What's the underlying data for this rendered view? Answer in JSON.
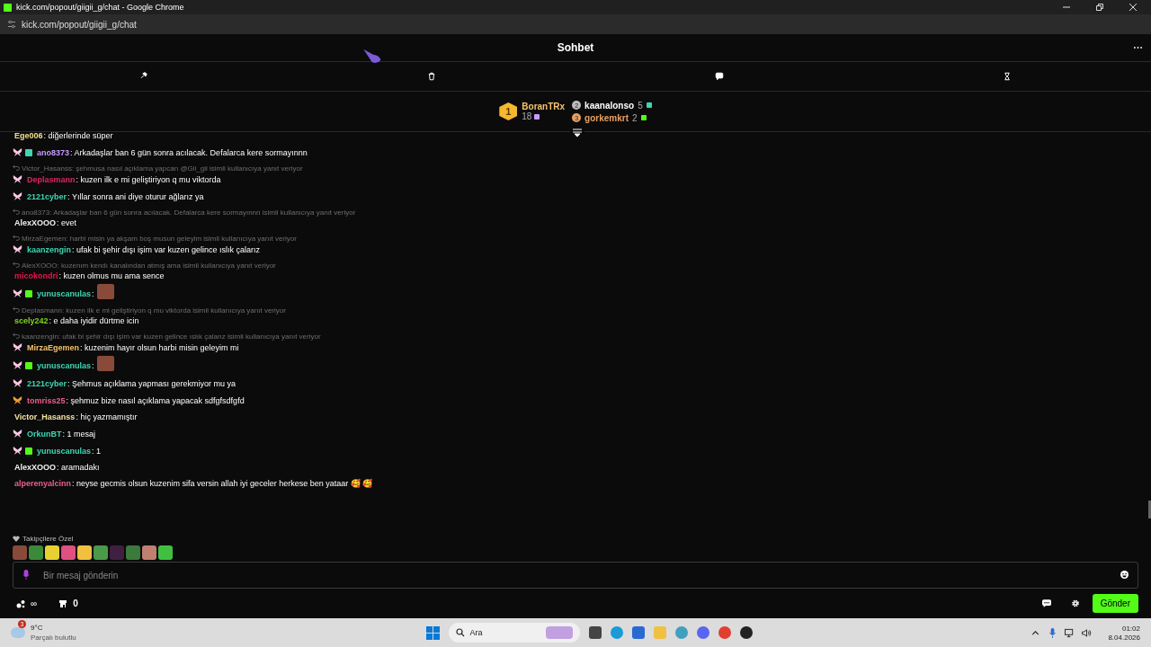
{
  "window": {
    "title": "kick.com/popout/giigii_g/chat - Google Chrome",
    "address": "kick.com/popout/giigii_g/chat"
  },
  "chat": {
    "title": "Sohbet"
  },
  "mod_tools": [
    {
      "kind": "hammer"
    },
    {
      "kind": "trash"
    },
    {
      "kind": "chat"
    },
    {
      "kind": "hourglass"
    }
  ],
  "leaderboard": {
    "top": {
      "rank": "1",
      "name": "BoranTRx",
      "count": "18"
    },
    "others": [
      {
        "rank": "2",
        "name": "kaanalonso",
        "count": "5",
        "color": "#ffffff",
        "gift": {
          "color": "#3ed6b2"
        }
      },
      {
        "rank": "3",
        "name": "gorkemkrt",
        "count": "2",
        "color": "#e8a060",
        "gift": {
          "color": "#53fc18"
        }
      }
    ]
  },
  "messages": [
    {
      "user": "Ege006",
      "color": "#f0e08a",
      "text": ": diğerlerinde süper"
    },
    {
      "user": "ano8373",
      "color": "#c79bff",
      "text": ": Arkadaşlar ban 6 gün sonra acılacak. Defalarca kere sormayınnn",
      "badges": [
        {
          "kind": "butterfly",
          "color": "#ffc8e6"
        },
        {
          "kind": "gift",
          "color": "#3ed6b2"
        }
      ]
    },
    {
      "reply": "Victor_Hasanss: şehmusa nasıl açıklama yapcan @Gii_gii isimli kullanıcıya yanıt veriyor",
      "user": "Deplasmann",
      "color": "#e0245e",
      "text": ": kuzen ilk e mi geliştiriyon q mu viktorda",
      "badges": [
        {
          "kind": "butterfly",
          "color": "#ffc8e6"
        }
      ]
    },
    {
      "user": "2121cyber",
      "color": "#3ed6b2",
      "text": ": Yıllar sonra ani diye oturur ağlarız ya",
      "badges": [
        {
          "kind": "butterfly",
          "color": "#ffc8e6"
        }
      ]
    },
    {
      "reply": "ano8373: Arkadaşlar ban 6 gün sonra acılacak. Defalarca kere sormayınnn isimli kullanıcıya yanıt veriyor",
      "user": "AlexXOOO",
      "color": "#f2f2f2",
      "text": ": evet"
    },
    {
      "reply": "MirzaEgemen: harbi misin ya akşam boş musun geleyim isimli kullanıcıya yanıt veriyor",
      "user": "kaanzengin",
      "color": "#3ed6b2",
      "text": ": ufak bi şehir dışı işim var kuzen gelince ıslık çalarız",
      "badges": [
        {
          "kind": "butterfly",
          "color": "#ffc8e6"
        }
      ]
    },
    {
      "reply": "AlexXOOO: kuzenım kendı kanalından atmış ama isimli kullanıcıya yanıt veriyor",
      "user": "micokondri",
      "color": "#e8174a",
      "text": ": kuzen olmus mu ama sence"
    },
    {
      "user": "yunuscanulas",
      "color": "#3ed6b2",
      "text": ":",
      "emote": true,
      "badges": [
        {
          "kind": "butterfly",
          "color": "#ffc8e6"
        },
        {
          "kind": "gift",
          "color": "#53fc18"
        }
      ]
    },
    {
      "reply": "Deplasmann: kuzen ilk e mi geliştiriyon q mu viktorda isimli kullanıcıya yanıt veriyor",
      "user": "scely242",
      "color": "#7ed321",
      "text": ": e daha iyidir dürtme icin"
    },
    {
      "reply": "kaanzengin: ufak bi şehir dışı işim var kuzen gelince ıslık çalarız isimli kullanıcıya yanıt veriyor",
      "user": "MirzaEgemen",
      "color": "#f5c26b",
      "text": ": kuzenim hayır olsun harbi misin geleyim mi",
      "badges": [
        {
          "kind": "butterfly",
          "color": "#ffc8e6"
        }
      ]
    },
    {
      "user": "yunuscanulas",
      "color": "#3ed6b2",
      "text": ":",
      "emote": true,
      "badges": [
        {
          "kind": "butterfly",
          "color": "#ffc8e6"
        },
        {
          "kind": "gift",
          "color": "#53fc18"
        }
      ]
    },
    {
      "user": "2121cyber",
      "color": "#3ed6b2",
      "text": ": Şehmus açıklama yapması gerekmiyor mu ya",
      "badges": [
        {
          "kind": "butterfly",
          "color": "#ffc8e6"
        }
      ]
    },
    {
      "user": "tomriss25",
      "color": "#e8608a",
      "text": ": şehmuz bize nasıl açıklama yapacak sdfgfsdfgfd",
      "badges": [
        {
          "kind": "butterfly",
          "color": "#f0a030"
        }
      ]
    },
    {
      "user": "Victor_Hasanss",
      "color": "#f0e2a0",
      "text": ": hiç yazmamıştır"
    },
    {
      "user": "OrkunBT",
      "color": "#3ed6b2",
      "text": ": 1 mesaj",
      "badges": [
        {
          "kind": "butterfly",
          "color": "#ffc8e6"
        }
      ]
    },
    {
      "user": "yunuscanulas",
      "color": "#3ed6b2",
      "text": ": 1",
      "badges": [
        {
          "kind": "butterfly",
          "color": "#ffc8e6"
        },
        {
          "kind": "gift",
          "color": "#53fc18"
        }
      ]
    },
    {
      "user": "AlexXOOO",
      "color": "#f2f2f2",
      "text": ": aramadakı"
    },
    {
      "user": "alperenyalcinn",
      "color": "#e8608a",
      "text": ": neyse gecmis olsun kuzenim sifa versin allah iyi geceler herkese ben yataar 🥰 🥰"
    }
  ],
  "followers_only": {
    "label": "Takipçilere Özel",
    "emotes": [
      {
        "color": "#8a4a3a"
      },
      {
        "color": "#3a8a3a"
      },
      {
        "color": "#e8d030"
      },
      {
        "color": "#e05080"
      },
      {
        "color": "#f0c040"
      },
      {
        "color": "#4a9a4a"
      },
      {
        "color": "#402040"
      },
      {
        "color": "#3a7a3a"
      },
      {
        "color": "#c08070"
      },
      {
        "color": "#40c040"
      }
    ]
  },
  "input": {
    "placeholder": "Bir mesaj gönderin"
  },
  "footer": {
    "points": "∞",
    "store": "0",
    "send": "Gönder"
  },
  "taskbar": {
    "temp": "9°C",
    "weather": "Parçalı bulutlu",
    "weather_badge": "3",
    "search": "Ara",
    "time": "01:02",
    "date": "8.04.2026"
  }
}
